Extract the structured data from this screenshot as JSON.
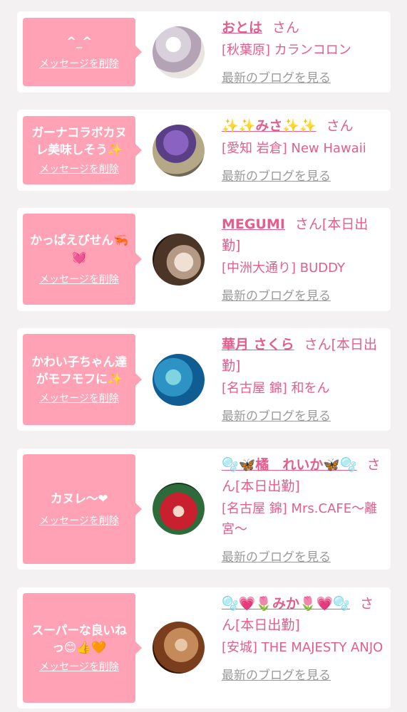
{
  "delete_label": "メッセージを削除",
  "blog_label": "最新のブログを見る",
  "san": "さん",
  "cards": [
    {
      "message": "^_^",
      "name": "おとは",
      "attendance": "",
      "shop": "[秋葉原] カランコロン",
      "avatar_colors": [
        "#c7b9c8",
        "#edeae6"
      ]
    },
    {
      "message": "ガーナコラボカヌレ美味しそう✨",
      "name": "✨✨みさ✨✨",
      "attendance": "",
      "shop": "[愛知 岩倉] New Hawaii",
      "avatar_colors": [
        "#7650a6",
        "#9c8e6f"
      ]
    },
    {
      "message": "かっぱえびせん🦐💓",
      "name": "MEGUMI",
      "attendance": "[本日出勤]",
      "shop": "[中洲大通り] BUDDY",
      "avatar_colors": [
        "#3b2a1c",
        "#d7c4b2"
      ]
    },
    {
      "message": "かわい子ちゃん達がモフモフに✨",
      "name": "華月 さくら",
      "attendance": "[本日出勤]",
      "shop": "[名古屋 錦] 和をん",
      "avatar_colors": [
        "#13649c",
        "#4ac0d2"
      ]
    },
    {
      "message": "カヌレ〜❤",
      "name": "🫧🦋橘　れいか🦋🫧",
      "attendance": "[本日出勤]",
      "shop": "[名古屋 錦] Mrs.CAFE〜離宮〜",
      "avatar_colors": [
        "#1a4a2a",
        "#c22030"
      ]
    },
    {
      "message": "スーパーな良いねっ😊👍🧡",
      "name": "🫧💗🌷みか🌷💗🫧",
      "attendance": "[本日出勤]",
      "shop": "[安城] THE MAJESTY ANJO",
      "avatar_colors": [
        "#3a1c10",
        "#c58a5a"
      ]
    }
  ]
}
